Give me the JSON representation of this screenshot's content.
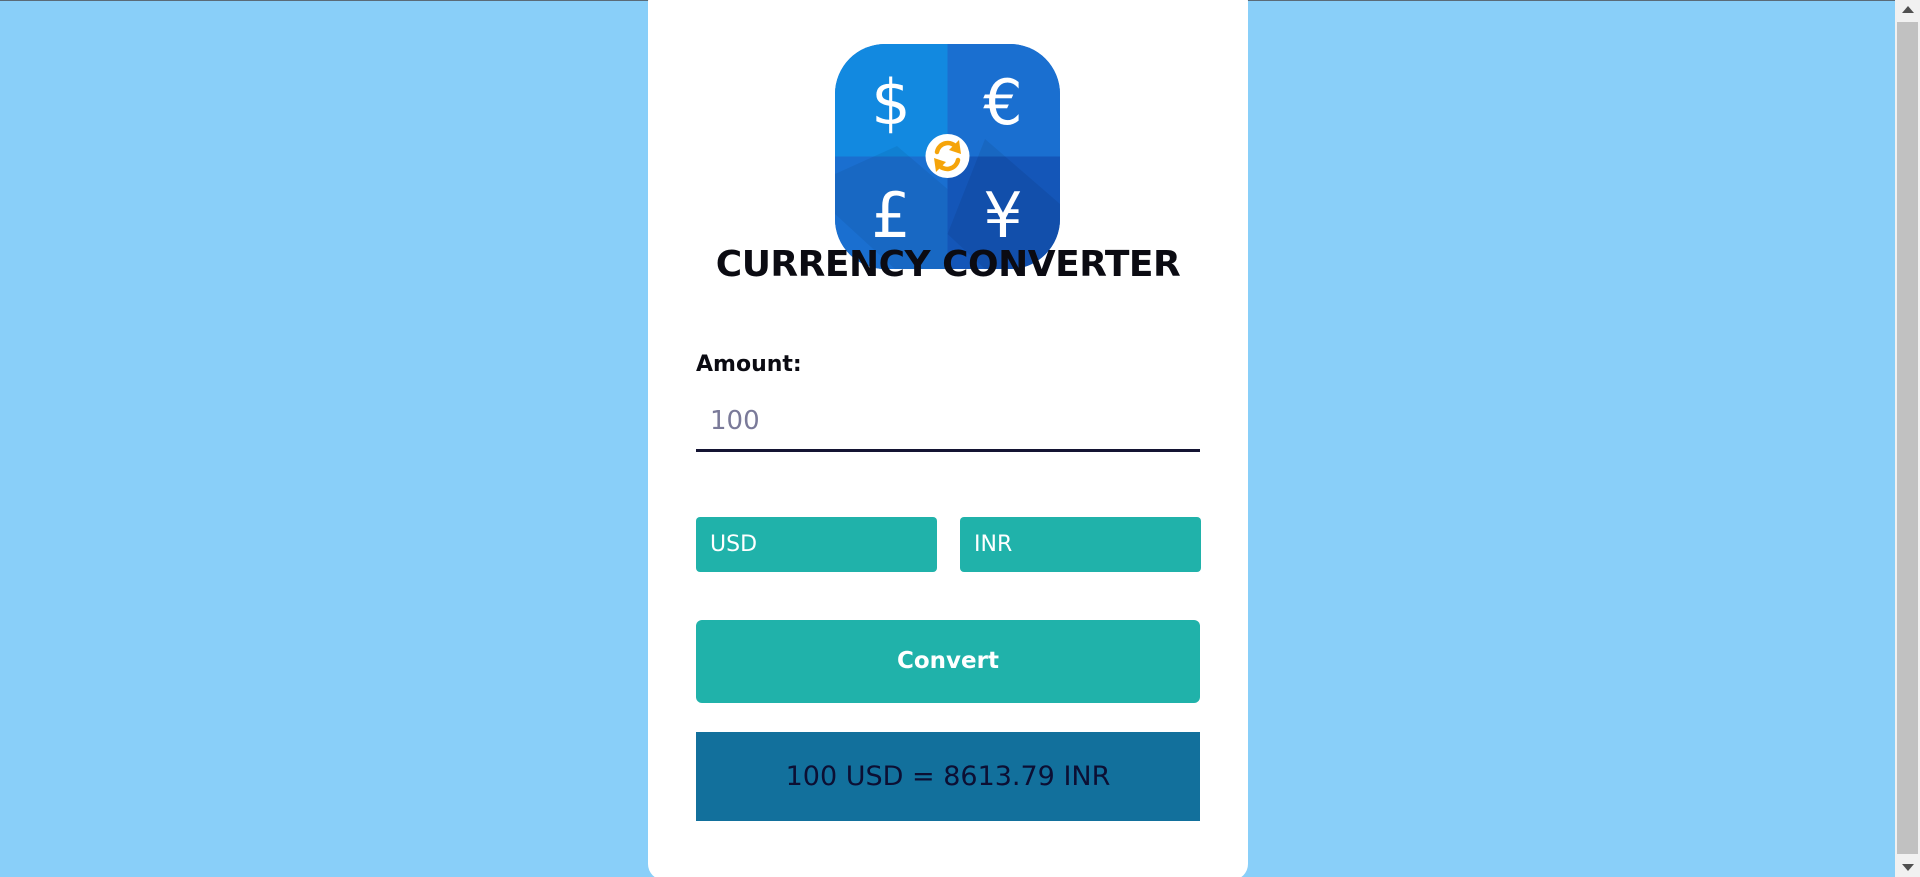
{
  "app": {
    "title": "CURRENCY CONVERTER"
  },
  "logo": {
    "icon_name": "currency-exchange-icon",
    "symbols": [
      "$",
      "€",
      "£",
      "¥"
    ],
    "colors": {
      "tile_top_left": "#1289e0",
      "tile_top_right": "#1a6fd0",
      "tile_bottom_left": "#1a6fd0",
      "tile_bottom_right": "#1456b8",
      "center_circle": "#ffffff",
      "arrows": "#f5a40a"
    }
  },
  "amount": {
    "label": "Amount:",
    "value": "100",
    "placeholder": ""
  },
  "currencies": {
    "from": "USD",
    "to": "INR"
  },
  "convert_button": {
    "label": "Convert"
  },
  "result": {
    "text": "100 USD = 8613.79 INR"
  },
  "colors": {
    "page_background": "#89cff9",
    "card_background": "#ffffff",
    "accent": "#20b2aa",
    "result_background": "#12709c"
  }
}
